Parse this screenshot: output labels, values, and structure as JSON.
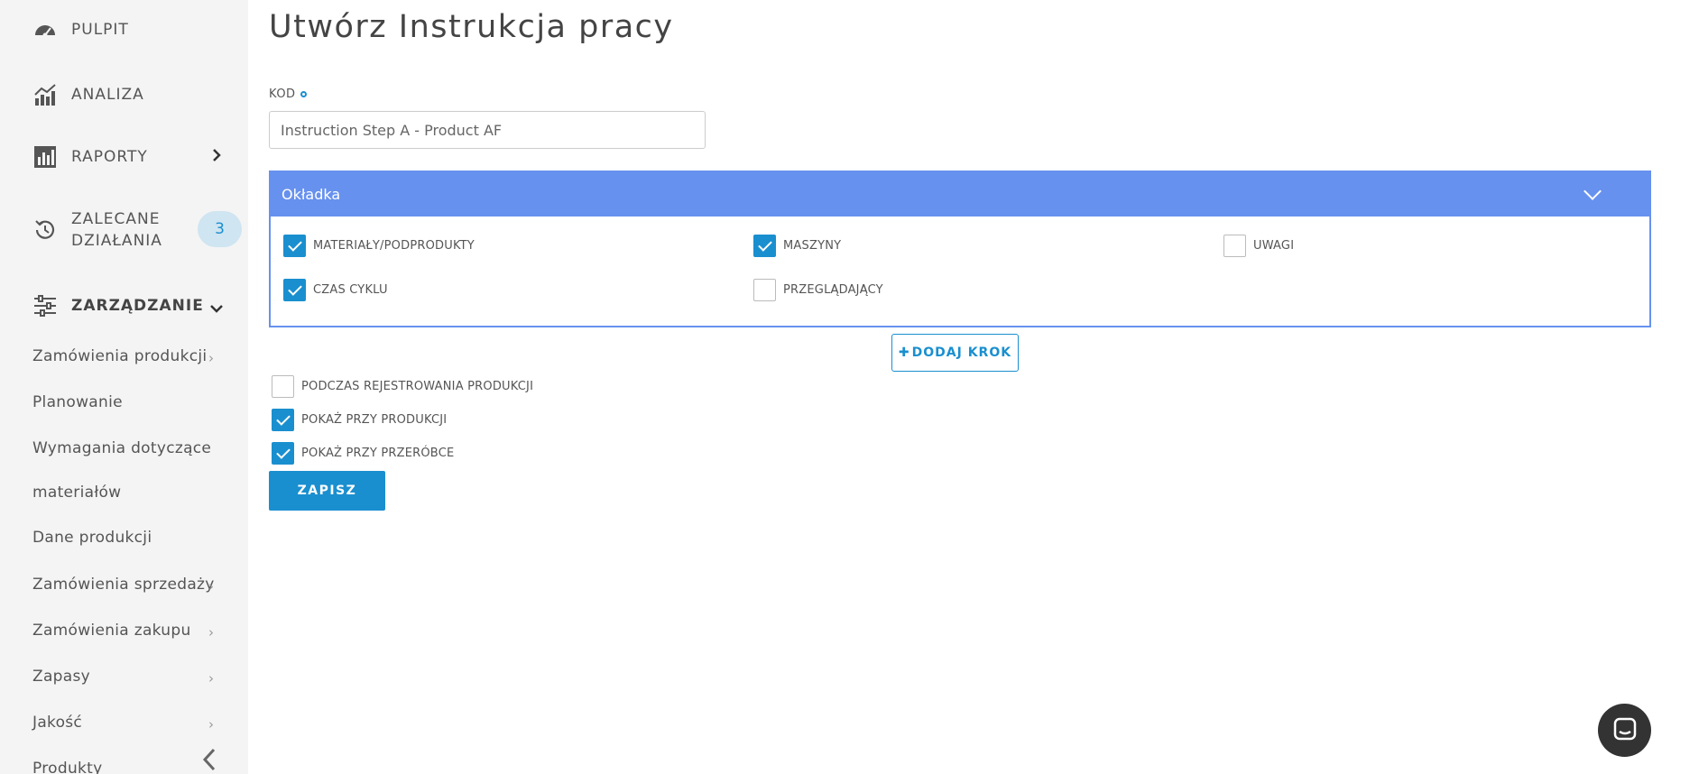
{
  "sidebar": {
    "dashboard": "PULPIT",
    "analysis": "ANALIZA",
    "reports": "RAPORTY",
    "recommended_line1": "ZALECANE",
    "recommended_line2": "DZIAŁANIA",
    "recommended_count": "3",
    "management": "ZARZĄDZANIE",
    "sub_items": [
      "Zamówienia produkcji",
      "Planowanie",
      "Wymagania dotyczące",
      "materiałów",
      "Dane produkcji",
      "Zamówienia sprzedaży",
      "Zamówienia zakupu",
      "Zapasy",
      "Jakość",
      "Produkty"
    ]
  },
  "main": {
    "title": "Utwórz Instrukcja pracy",
    "kod_label": "KOD",
    "kod_value": "Instruction Step A - Product AF",
    "panel_title": "Okładka",
    "panel_checks": [
      {
        "label": "MATERIAŁY/PODPRODUKTY",
        "checked": true
      },
      {
        "label": "MASZYNY",
        "checked": true
      },
      {
        "label": "UWAGI",
        "checked": false
      },
      {
        "label": "CZAS CYKLU",
        "checked": true
      },
      {
        "label": "PRZEGLĄDAJĄCY",
        "checked": false
      }
    ],
    "add_step_label": "DODAJ KROK",
    "options": [
      {
        "label": "PODCZAS REJESTROWANIA PRODUKCJI",
        "checked": false
      },
      {
        "label": "POKAŻ PRZY PRODUKCJI",
        "checked": true
      },
      {
        "label": "POKAŻ PRZY PRZERÓBCE",
        "checked": true
      }
    ],
    "save_label": "ZAPISZ"
  },
  "colors": {
    "accent": "#1a8fcf",
    "panel_header": "#6791ee",
    "sidebar_bg": "#f4f4f4"
  }
}
